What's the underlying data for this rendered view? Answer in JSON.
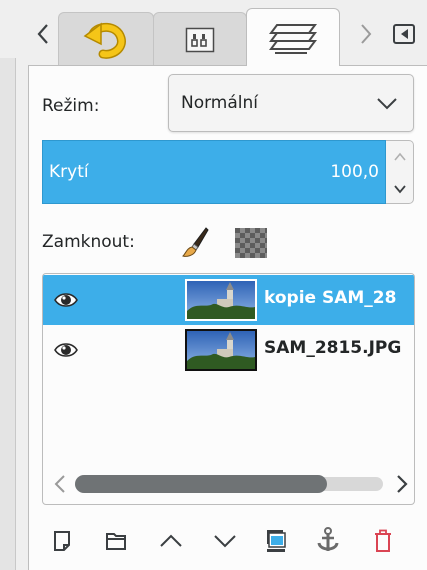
{
  "tabs": {
    "items": [
      {
        "icon": "undo-history-icon"
      },
      {
        "icon": "device-status-icon"
      },
      {
        "icon": "layers-icon",
        "active": true
      }
    ],
    "scroll_left_icon": "chevron-left-icon",
    "scroll_right_icon": "chevron-right-icon",
    "menu_icon": "tab-menu-icon"
  },
  "mode": {
    "label": "Režim:",
    "value": "Normální"
  },
  "opacity": {
    "label": "Krytí",
    "value": "100,0"
  },
  "lock": {
    "label": "Zamknout:",
    "icons": [
      "lock-pixels-brush-icon",
      "lock-alpha-checker-icon"
    ]
  },
  "layers": [
    {
      "name": "kopie SAM_28",
      "selected": true,
      "visible": true
    },
    {
      "name": "SAM_2815.JPG",
      "selected": false,
      "visible": true
    }
  ],
  "toolbar": {
    "icons": [
      "new-layer-icon",
      "new-layer-group-icon",
      "raise-layer-icon",
      "lower-layer-icon",
      "duplicate-layer-icon",
      "anchor-layer-icon",
      "delete-layer-icon"
    ]
  },
  "colors": {
    "accent": "#3daee9",
    "delete": "#da4453",
    "panel_bg": "#fcfcfc",
    "window_bg": "#efefef"
  }
}
